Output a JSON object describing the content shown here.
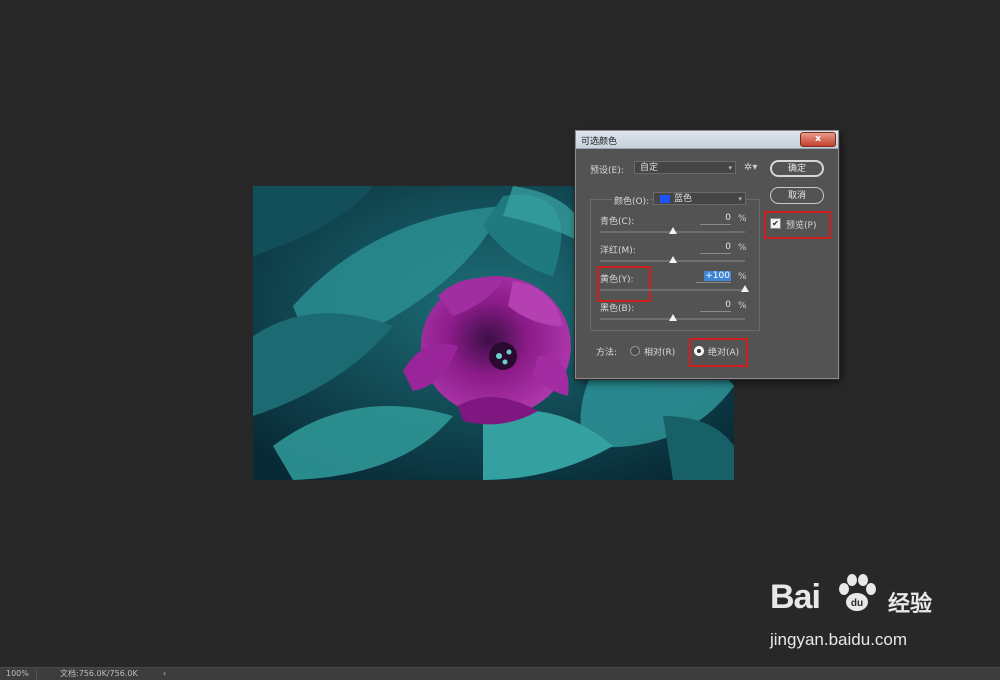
{
  "status_bar": {
    "zoom": "100%",
    "doc_info": "文档:756.0K/756.0K",
    "arrow": "›"
  },
  "dialog": {
    "title": "可选颜色",
    "close_label": "x",
    "preset_label": "预设(E):",
    "preset_value": "自定",
    "ok_label": "确定",
    "cancel_label": "取消",
    "preview_label": "预览(P)",
    "preview_checked": true,
    "colors_label": "颜色(O):",
    "colors_value": "蓝色",
    "colors_swatch": "#1a55ff",
    "sliders": [
      {
        "label": "青色(C):",
        "value": "0",
        "unit": "%",
        "level": 0
      },
      {
        "label": "洋红(M):",
        "value": "0",
        "unit": "%",
        "level": 0
      },
      {
        "label": "黄色(Y):",
        "value": "+100",
        "unit": "%",
        "level": 100
      },
      {
        "label": "黑色(B):",
        "value": "0",
        "unit": "%",
        "level": 0
      }
    ],
    "method_label": "方法:",
    "method_relative": "相对(R)",
    "method_absolute": "绝对(A)",
    "method_selected": "absolute"
  },
  "watermark": {
    "brand_latin": "Bai",
    "brand_cn": "经验",
    "url": "jingyan.baidu.com"
  },
  "colors": {
    "highlight": "#d11e1e",
    "selection": "#3f86d6",
    "canvas_bg": "#282829"
  }
}
